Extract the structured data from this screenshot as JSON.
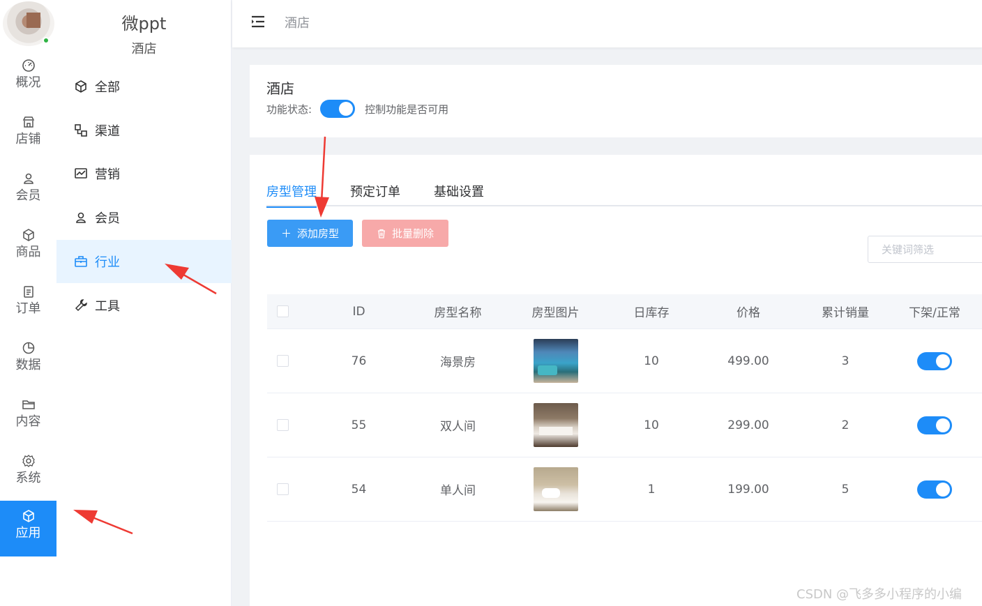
{
  "rail": {
    "items": [
      {
        "label": "概况",
        "icon": "dashboard-icon"
      },
      {
        "label": "店铺",
        "icon": "store-icon"
      },
      {
        "label": "会员",
        "icon": "user-icon"
      },
      {
        "label": "商品",
        "icon": "box-icon"
      },
      {
        "label": "订单",
        "icon": "clipboard-icon"
      },
      {
        "label": "数据",
        "icon": "pie-chart-icon"
      },
      {
        "label": "内容",
        "icon": "folder-icon"
      },
      {
        "label": "系统",
        "icon": "gear-icon"
      },
      {
        "label": "应用",
        "icon": "cube-icon",
        "active": true
      }
    ]
  },
  "brand": {
    "title": "微ppt",
    "subtitle": "酒店"
  },
  "subnav": {
    "items": [
      {
        "label": "全部",
        "icon": "cube-icon"
      },
      {
        "label": "渠道",
        "icon": "channels-icon"
      },
      {
        "label": "营销",
        "icon": "trend-chart-icon"
      },
      {
        "label": "会员",
        "icon": "user-icon"
      },
      {
        "label": "行业",
        "icon": "briefcase-icon",
        "active": true
      },
      {
        "label": "工具",
        "icon": "wrench-icon"
      }
    ]
  },
  "topbar": {
    "breadcrumb": "酒店"
  },
  "feature": {
    "title": "酒店",
    "status_label": "功能状态:",
    "status_on": true,
    "status_hint": "控制功能是否可用"
  },
  "tabs": [
    {
      "label": "房型管理",
      "active": true
    },
    {
      "label": "预定订单"
    },
    {
      "label": "基础设置"
    }
  ],
  "toolbar": {
    "add_label": "添加房型",
    "delete_label": "批量删除",
    "search_placeholder": "关键词筛选"
  },
  "table": {
    "headers": {
      "id": "ID",
      "name": "房型名称",
      "image": "房型图片",
      "stock": "日库存",
      "price": "价格",
      "sales": "累计销量",
      "status": "下架/正常"
    },
    "rows": [
      {
        "id": "76",
        "name": "海景房",
        "image": "sea-view-room-photo",
        "stock": "10",
        "price": "499.00",
        "sales": "3",
        "on": true
      },
      {
        "id": "55",
        "name": "双人间",
        "image": "twin-room-photo",
        "stock": "10",
        "price": "299.00",
        "sales": "2",
        "on": true
      },
      {
        "id": "54",
        "name": "单人间",
        "image": "single-room-photo",
        "stock": "1",
        "price": "199.00",
        "sales": "5",
        "on": true
      }
    ]
  },
  "watermark": "CSDN @飞多多小程序的小编",
  "colors": {
    "primary": "#1d8cf8",
    "danger_light": "#f7a9a9",
    "annotation": "#ee3a33"
  }
}
